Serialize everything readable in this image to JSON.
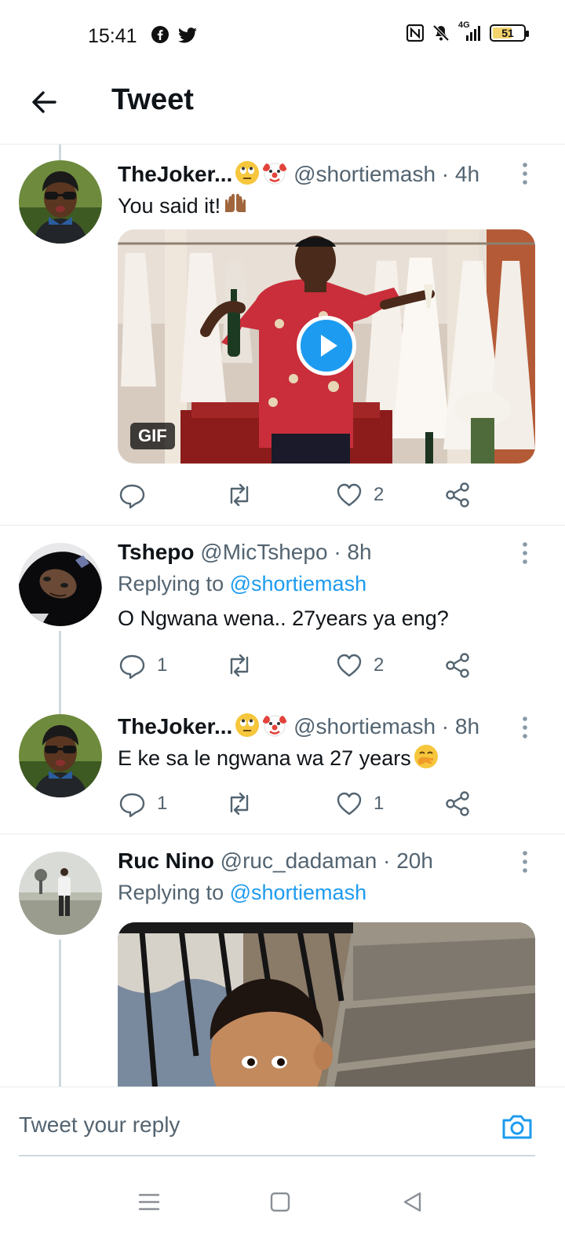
{
  "status_bar": {
    "time": "15:41",
    "battery": "51",
    "network": "4G",
    "icons": [
      "facebook-icon",
      "twitter-icon",
      "nfc-icon",
      "mute-icon",
      "signal-icon",
      "battery-icon"
    ]
  },
  "header": {
    "title": "Tweet",
    "back_icon": "arrow-left-icon"
  },
  "tweets": [
    {
      "name": "TheJoker...",
      "emojis": [
        "face-with-rolling-eyes",
        "clown-face"
      ],
      "handle": "@shortiemash",
      "time": "· 4h",
      "text": "You said it!",
      "text_emoji": "palms-up-together",
      "media_badge": "GIF",
      "actions": {
        "reply": "",
        "retweet": "",
        "like": "2"
      }
    },
    {
      "name": "Tshepo",
      "handle": "@MicTshepo",
      "time": "· 8h",
      "replying_prefix": "Replying to",
      "replying_handle": "@shortiemash",
      "text": "O Ngwana wena.. 27years ya eng?",
      "actions": {
        "reply": "1",
        "retweet": "",
        "like": "2"
      }
    },
    {
      "name": "TheJoker...",
      "emojis": [
        "face-with-rolling-eyes",
        "clown-face"
      ],
      "handle": "@shortiemash",
      "time": "· 8h",
      "text": "E ke sa le ngwana wa 27 years",
      "text_emoji": "face-with-hand-over-mouth",
      "actions": {
        "reply": "1",
        "retweet": "",
        "like": "1"
      }
    },
    {
      "name": "Ruc Nino",
      "handle": "@ruc_dadaman",
      "time": "· 20h",
      "replying_prefix": "Replying to",
      "replying_handle": "@shortiemash"
    }
  ],
  "reply_bar": {
    "placeholder": "Tweet your reply",
    "camera_icon": "camera-icon"
  },
  "colors": {
    "accent": "#1d9bf0",
    "text_primary": "#0f1419",
    "text_secondary": "#536471",
    "divider": "#e6ecf0"
  }
}
